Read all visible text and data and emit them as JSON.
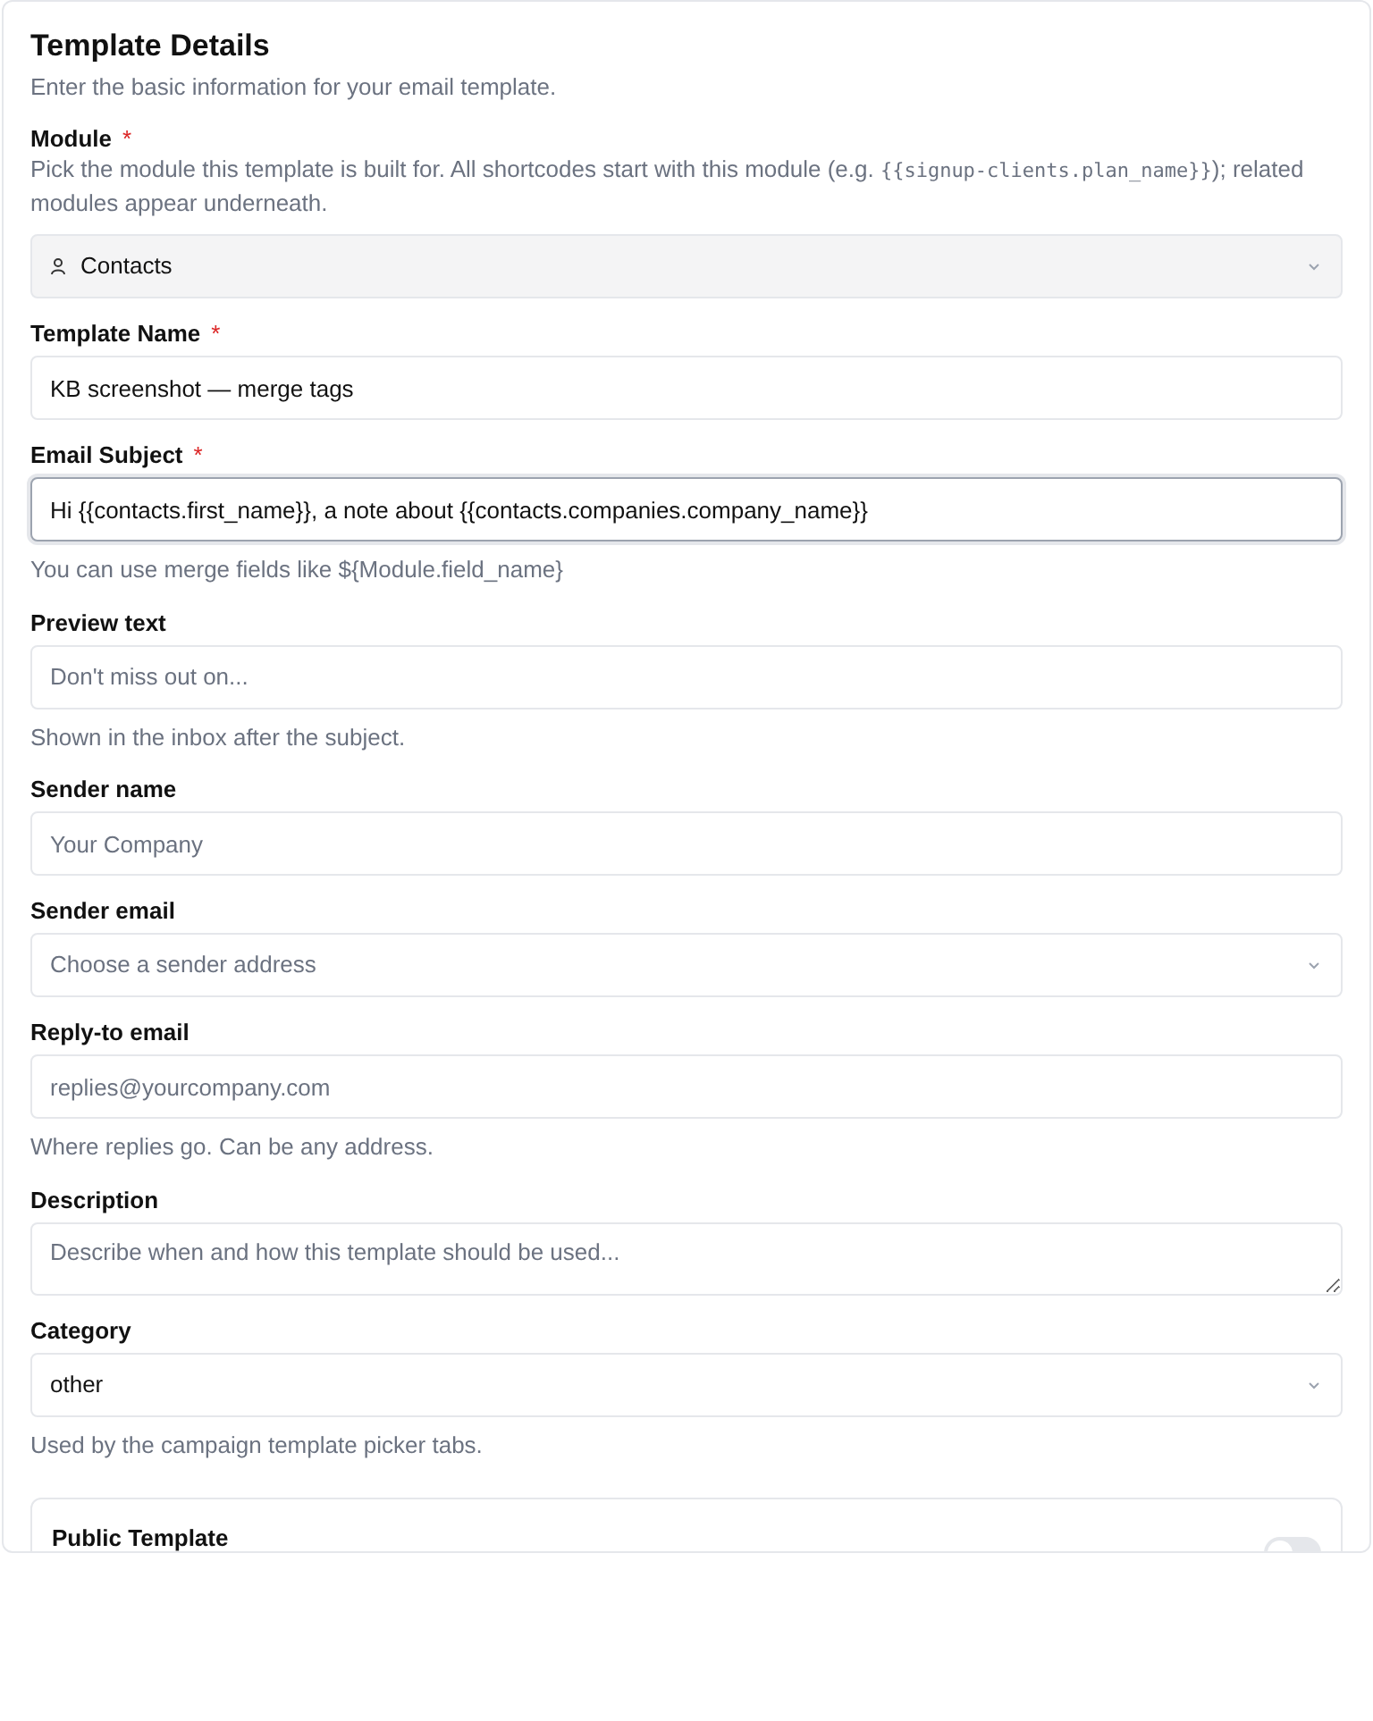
{
  "header": {
    "title": "Template Details",
    "subtitle": "Enter the basic information for your email template."
  },
  "fields": [
    {
      "kind": "module_select",
      "label": "Module",
      "required_mark": "*",
      "help_rich": "Pick the module this template is built for. All shortcodes start with this module (e.g. ",
      "help_code": "{{signup-clients.plan_name}}",
      "help_after": "); related modules appear underneath.",
      "value": "Contacts"
    },
    {
      "kind": "input",
      "label": "Template Name",
      "required_mark": "*",
      "value": "KB screenshot — merge tags",
      "focused": false
    },
    {
      "kind": "input",
      "label": "Email Subject",
      "required_mark": "*",
      "value": "Hi {{contacts.first_name}}, a note about {{contacts.companies.company_name}}",
      "focused": true,
      "note": "You can use merge fields like ${Module.field_name}"
    },
    {
      "kind": "input",
      "label": "Preview text",
      "placeholder": "Don't miss out on...",
      "focused": false,
      "note": "Shown in the inbox after the subject."
    },
    {
      "kind": "input",
      "label": "Sender name",
      "placeholder": "Your Company",
      "focused": false
    },
    {
      "kind": "select",
      "label": "Sender email",
      "placeholder": "Choose a sender address"
    },
    {
      "kind": "input",
      "label": "Reply-to email",
      "placeholder": "replies@yourcompany.com",
      "focused": false,
      "note": "Where replies go. Can be any address."
    },
    {
      "kind": "textarea",
      "label": "Description",
      "placeholder": "Describe when and how this template should be used...",
      "focused": false
    },
    {
      "kind": "select",
      "label": "Category",
      "value": "other",
      "note": "Used by the campaign template picker tabs."
    }
  ],
  "public_template": {
    "label": "Public Template",
    "on": false
  }
}
